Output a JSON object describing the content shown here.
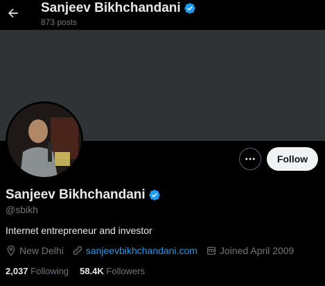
{
  "header": {
    "back_icon": "arrow-left-icon",
    "name": "Sanjeev Bikhchandani",
    "posts_count": "873 posts"
  },
  "profile": {
    "name": "Sanjeev Bikhchandani",
    "handle": "@sbikh",
    "bio": "Internet entrepreneur and investor",
    "verified_icon": "verified-badge-icon",
    "location": "New Delhi",
    "website": "sanjeevbikhchandani.com",
    "joined": "Joined April 2009",
    "following_count": "2,037",
    "following_label": "Following",
    "followers_count": "58.4K",
    "followers_label": "Followers"
  },
  "actions": {
    "more_icon": "more-options-icon",
    "follow_label": "Follow"
  },
  "colors": {
    "background": "#000000",
    "banner": "#2f3336",
    "accent": "#1d9bf0",
    "text": "#e7e9ea",
    "muted": "#71767b"
  }
}
